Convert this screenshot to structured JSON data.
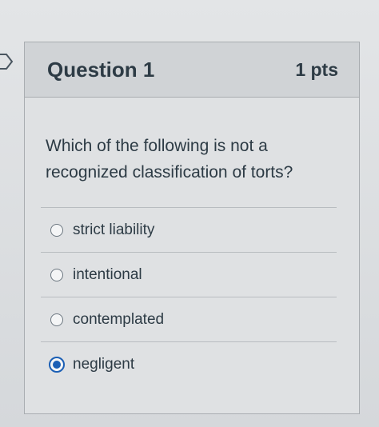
{
  "question": {
    "title": "Question 1",
    "points": "1 pts",
    "text": "Which of the following is not a recognized classification of torts?"
  },
  "answers": [
    {
      "label": "strict liability",
      "selected": false
    },
    {
      "label": "intentional",
      "selected": false
    },
    {
      "label": "contemplated",
      "selected": false
    },
    {
      "label": "negligent",
      "selected": true
    }
  ],
  "colors": {
    "accent": "#1b5fb5",
    "text": "#2d3b45"
  }
}
